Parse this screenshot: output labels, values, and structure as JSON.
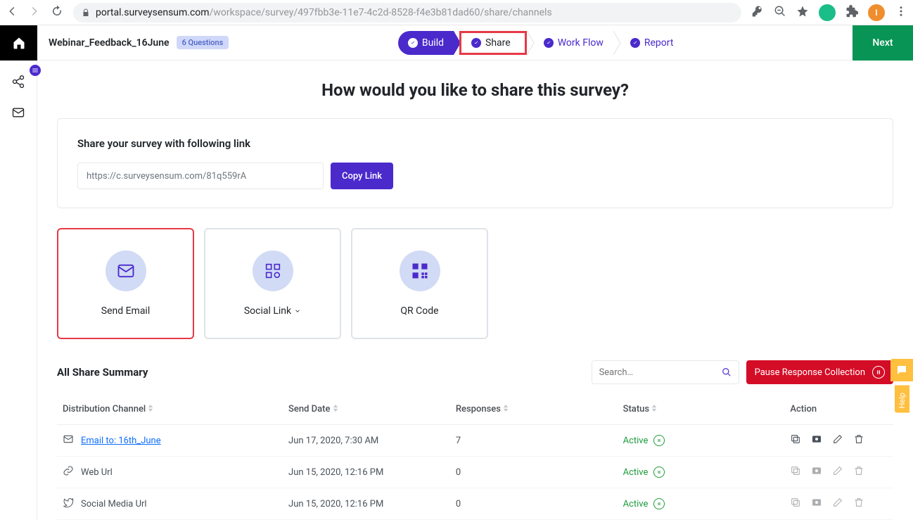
{
  "browser": {
    "url_host": "portal.surveysensum.com",
    "url_path": "/workspace/survey/497fbb3e-11e7-4c2d-8528-f4e3b81dad60/share/channels",
    "avatar_initial": "I"
  },
  "header": {
    "survey_name": "Webinar_Feedback_16June",
    "questions_badge": "6 Questions",
    "steps": {
      "build": "Build",
      "share": "Share",
      "workflow": "Work Flow",
      "report": "Report"
    },
    "next": "Next"
  },
  "page_title": "How would you like to share this survey?",
  "share_panel": {
    "label": "Share your survey with following link",
    "link_value": "https://c.surveysensum.com/81q559rA",
    "copy": "Copy Link"
  },
  "cards": {
    "email": "Send Email",
    "social": "Social Link",
    "qr": "QR Code"
  },
  "summary": {
    "title": "All Share Summary",
    "search_placeholder": "Search…",
    "pause": "Pause Response Collection"
  },
  "table": {
    "head": {
      "channel": "Distribution Channel",
      "send": "Send Date",
      "resp": "Responses",
      "status": "Status",
      "action": "Action"
    },
    "rows": [
      {
        "icon": "mail",
        "channel": "Email to: 16th_June",
        "link": true,
        "send": "Jun 17, 2020, 7:30 AM",
        "resp": "7",
        "status": "Active",
        "dim": false
      },
      {
        "icon": "link",
        "channel": "Web Url",
        "link": false,
        "send": "Jun 15, 2020, 12:16 PM",
        "resp": "0",
        "status": "Active",
        "dim": true
      },
      {
        "icon": "twitter",
        "channel": "Social Media Url",
        "link": false,
        "send": "Jun 15, 2020, 12:16 PM",
        "resp": "0",
        "status": "Active",
        "dim": true
      }
    ]
  },
  "help_label": "Help"
}
